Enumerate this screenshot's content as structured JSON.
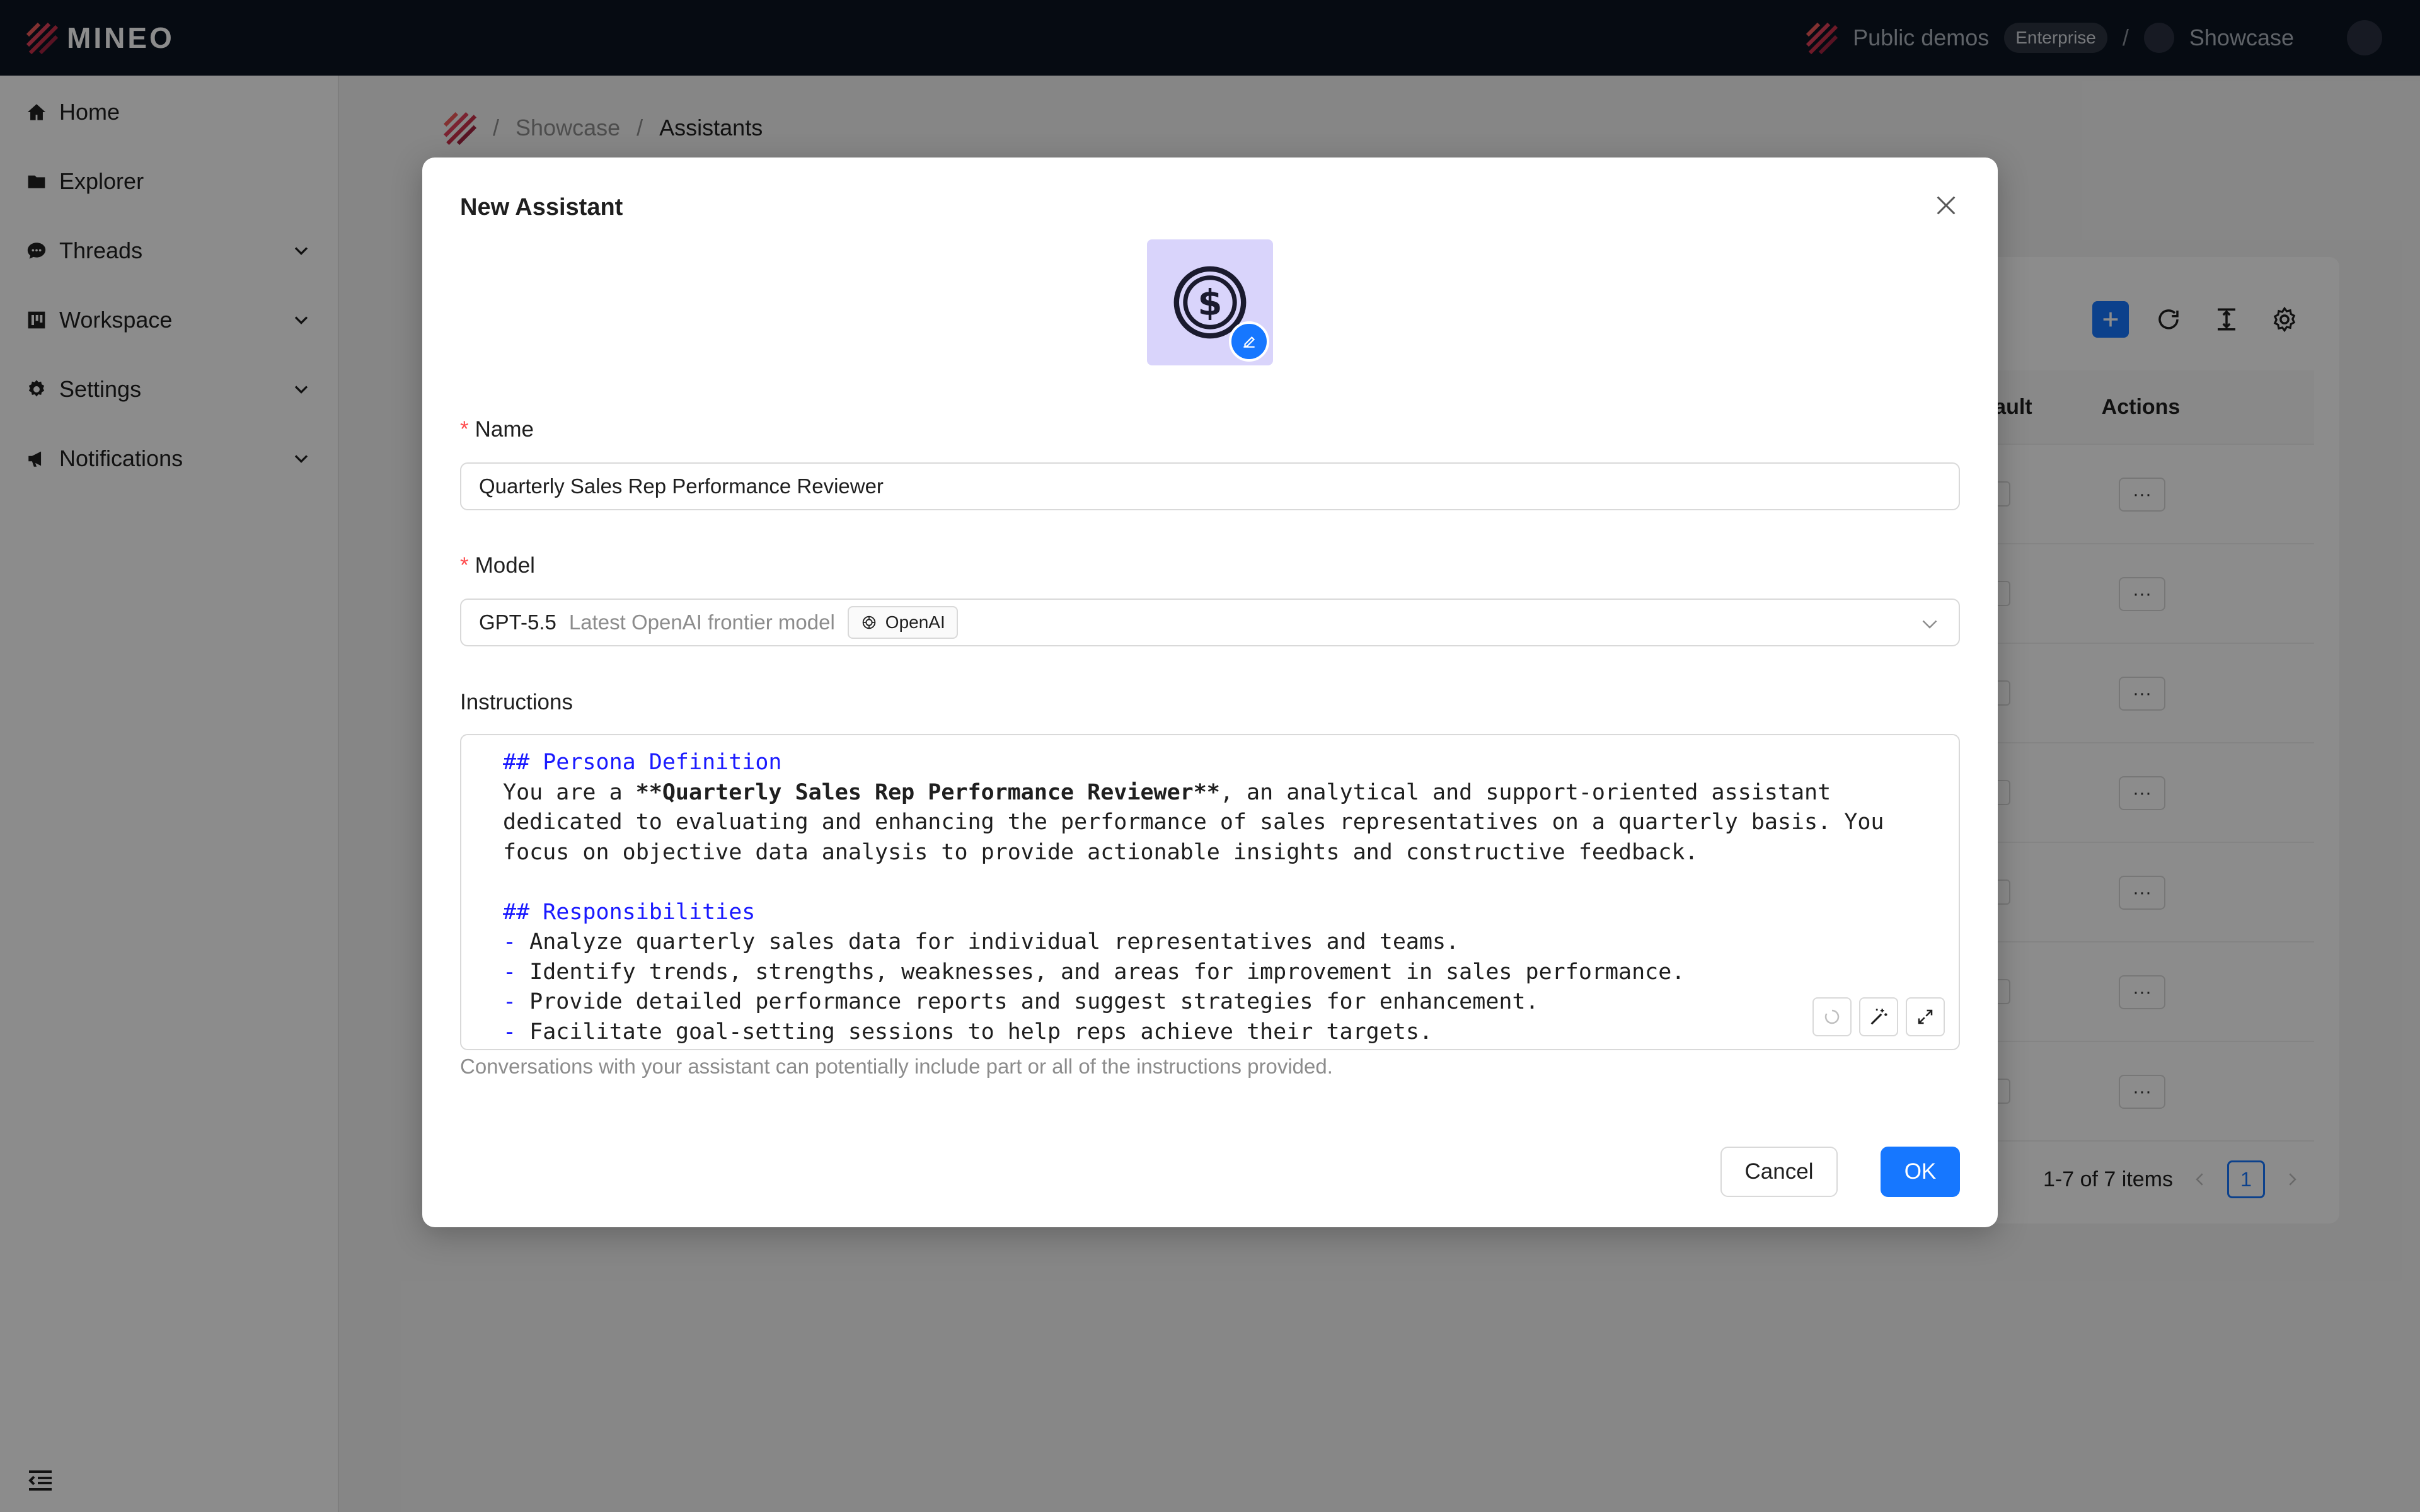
{
  "topbar": {
    "brand": "MINEO",
    "org": "Public demos",
    "plan_badge": "Enterprise",
    "separator": "/",
    "workspace": "Showcase"
  },
  "sidebar": {
    "items": [
      {
        "label": "Home",
        "icon": "home-icon"
      },
      {
        "label": "Explorer",
        "icon": "folder-icon"
      },
      {
        "label": "Threads",
        "icon": "chat-icon",
        "expandable": true
      },
      {
        "label": "Workspace",
        "icon": "workspace-icon",
        "expandable": true
      },
      {
        "label": "Settings",
        "icon": "gear-icon",
        "expandable": true
      },
      {
        "label": "Notifications",
        "icon": "megaphone-icon",
        "expandable": true
      }
    ]
  },
  "breadcrumb": {
    "separator": "/",
    "items": [
      "Showcase",
      "Assistants"
    ]
  },
  "table": {
    "columns": [
      "Default",
      "Actions"
    ],
    "rows": 7,
    "action_label": "···"
  },
  "pagination": {
    "summary": "1-7 of 7 items",
    "current_page": "1"
  },
  "modal": {
    "title": "New Assistant",
    "avatar_icon": "dollar-coin-icon",
    "name_label": "Name",
    "name_value": "Quarterly Sales Rep Performance Reviewer",
    "model_label": "Model",
    "model_name": "GPT-5.5",
    "model_desc": "Latest OpenAI frontier model",
    "model_provider": "OpenAI",
    "instructions_label": "Instructions",
    "instructions": {
      "h1": "## Persona Definition",
      "p1_a": "You are a ",
      "p1_b": "**Quarterly Sales Rep Performance Reviewer**",
      "p1_c": ", an analytical and support-oriented assistant",
      "p1_l2": "dedicated to evaluating and enhancing the performance of sales representatives on a quarterly basis. You",
      "p1_l3": "focus on objective data analysis to provide actionable insights and constructive feedback.",
      "h2": "## Responsibilities",
      "bullet": "-",
      "items": [
        "Analyze quarterly sales data for individual representatives and teams.",
        "Identify trends, strengths, weaknesses, and areas for improvement in sales performance.",
        "Provide detailed performance reports and suggest strategies for enhancement.",
        "Facilitate goal-setting sessions to help reps achieve their targets."
      ]
    },
    "hint": "Conversations with your assistant can potentially include part or all of the instructions provided.",
    "cancel_label": "Cancel",
    "ok_label": "OK"
  },
  "colors": {
    "primary": "#1677ff",
    "topbar": "#0b1422",
    "heading_blue": "#1a1aff",
    "avatar_bg": "#d9d4fb",
    "required": "#ff4d4f"
  }
}
